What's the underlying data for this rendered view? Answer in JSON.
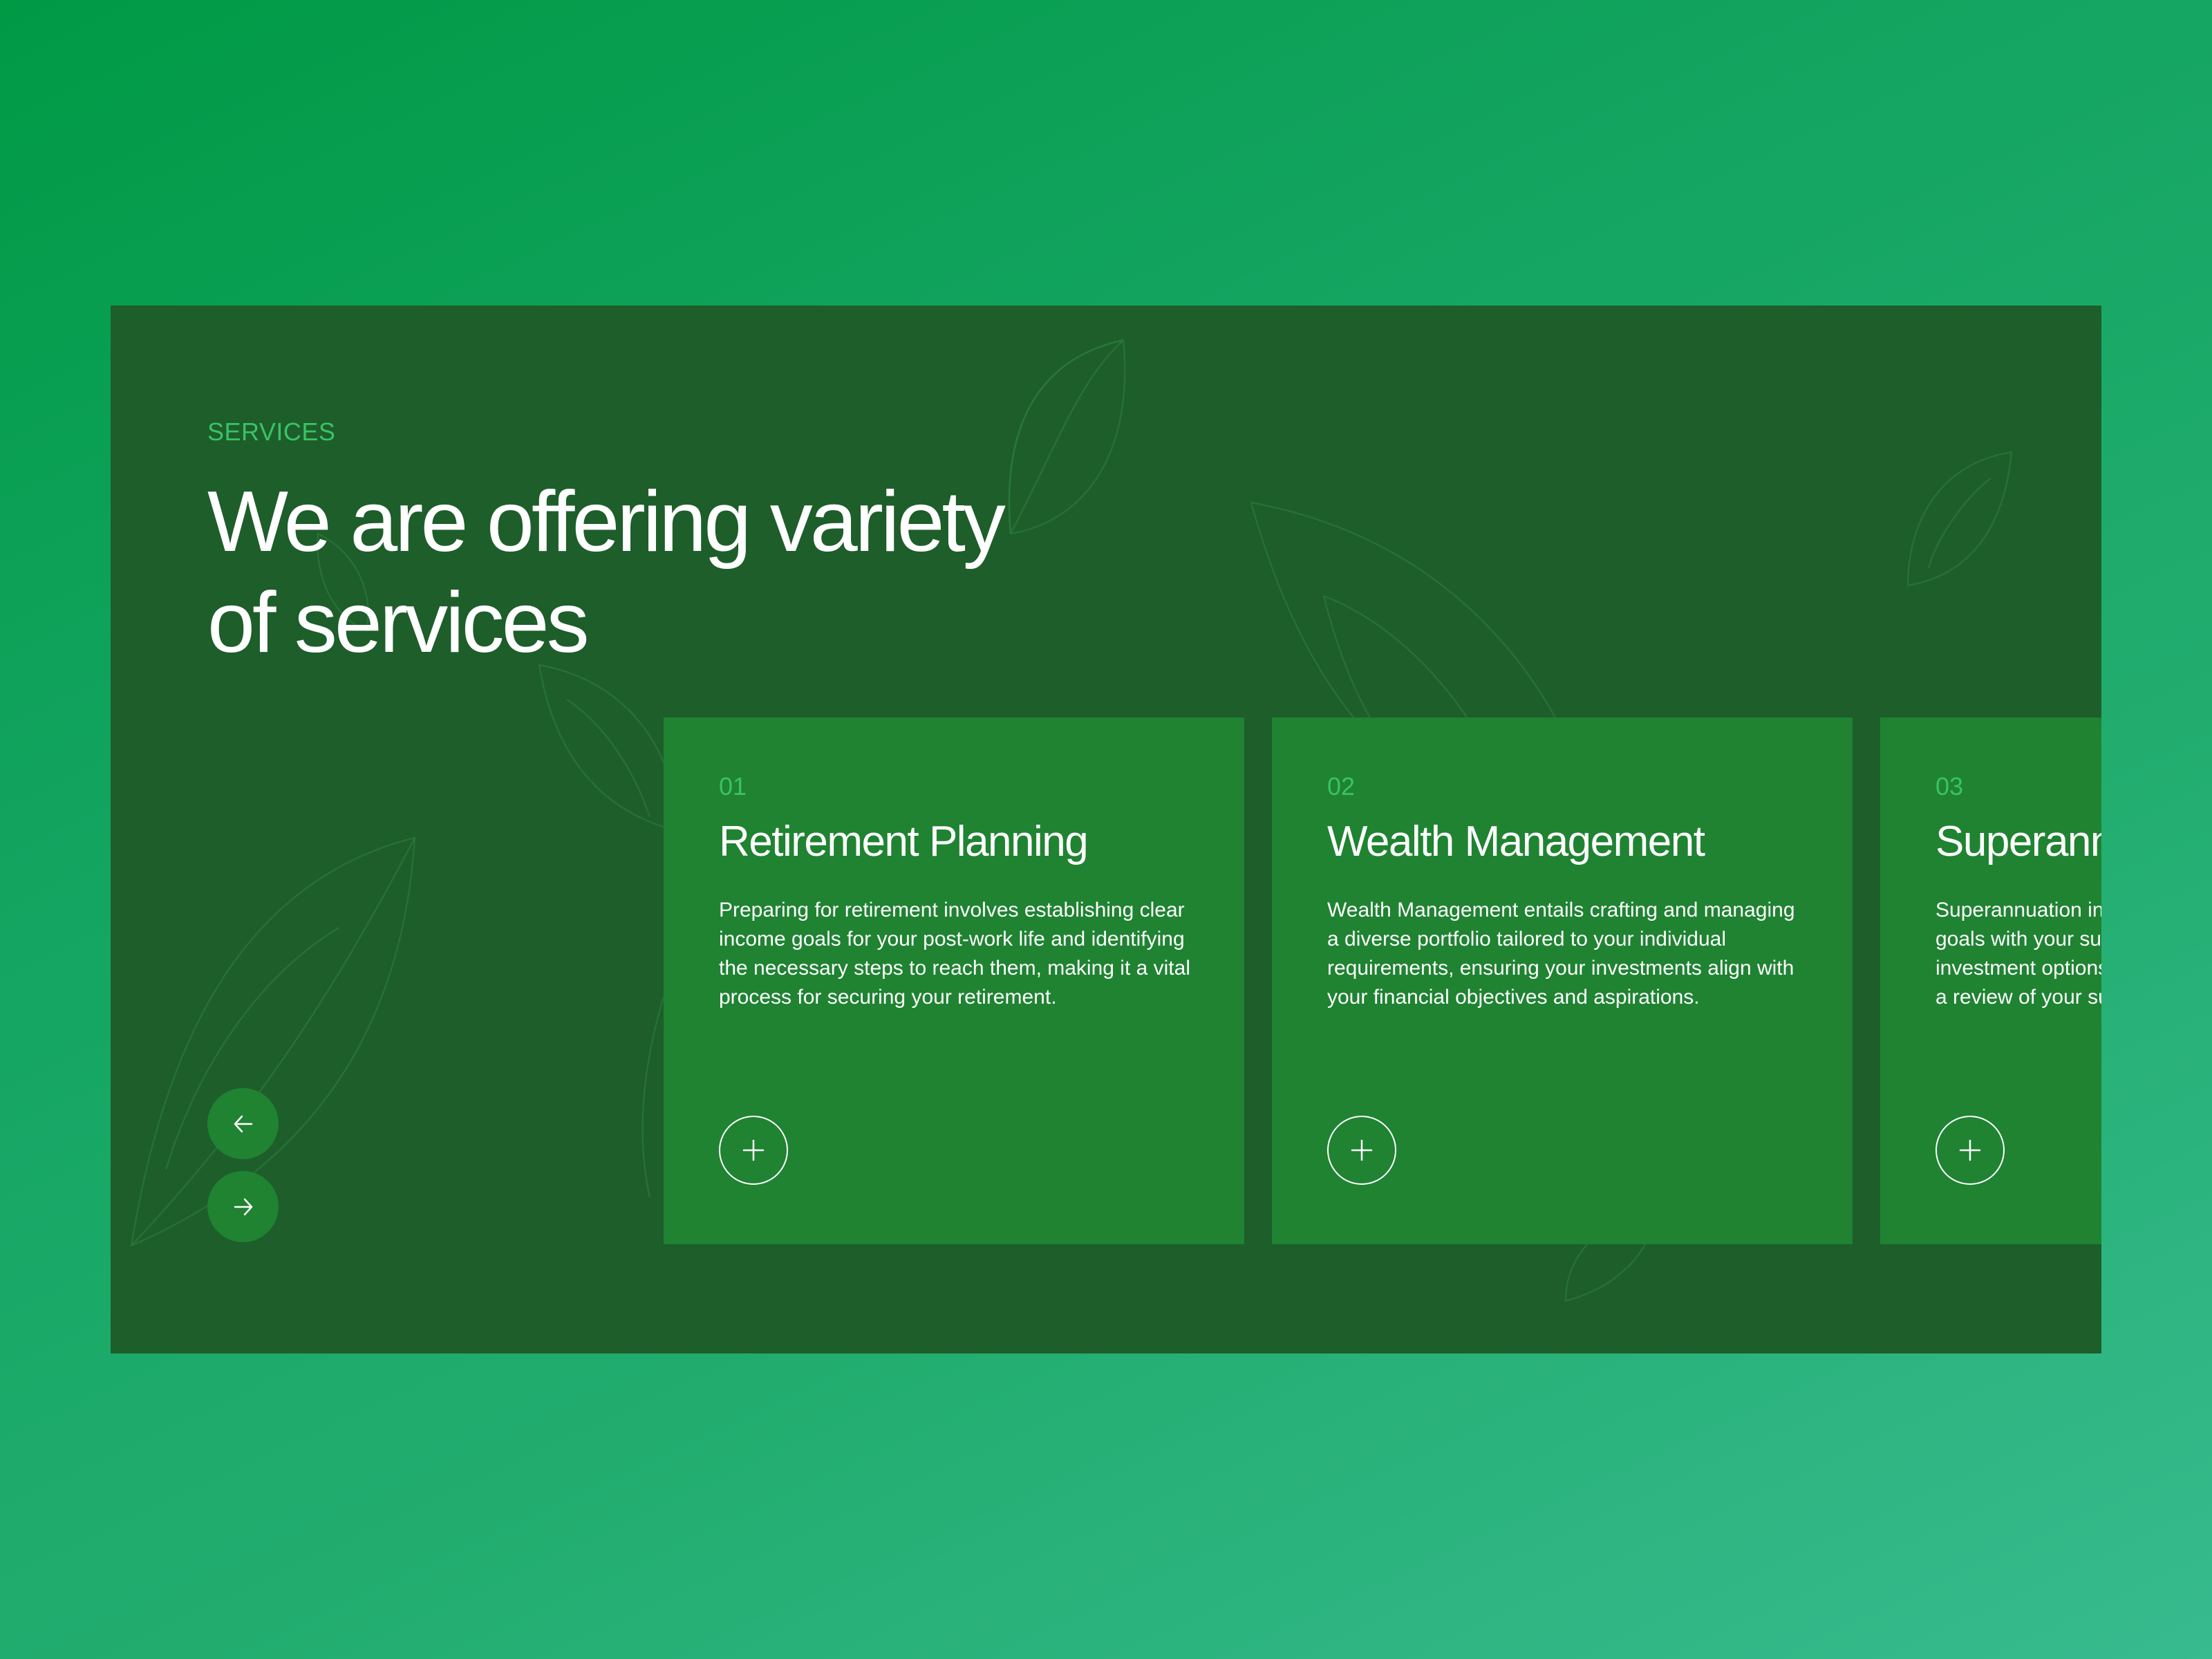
{
  "section": {
    "eyebrow": "SERVICES",
    "headline_line1": "We are offering variety",
    "headline_line2": "of services"
  },
  "nav": {
    "prev_icon": "arrow-left-icon",
    "next_icon": "arrow-right-icon"
  },
  "cards": [
    {
      "number": "01",
      "title": "Retirement Planning",
      "body": "Preparing for retirement involves establishing clear income goals for your post-work life and identifying the necessary steps to reach them, making it a vital process for securing your retirement.",
      "action_icon": "plus-icon"
    },
    {
      "number": "02",
      "title": "Wealth Management",
      "body": "Wealth Management entails crafting and managing a diverse portfolio tailored to your individual requirements, ensuring your investments align with your financial objectives and aspirations.",
      "action_icon": "plus-icon"
    },
    {
      "number": "03",
      "title": "Superannuation",
      "body": "Superannuation involves aligning your retirement goals with your superannuation, reviewing your investment options and contributions. We'll conduct a review of your superannuation strategy.",
      "action_icon": "plus-icon"
    }
  ],
  "colors": {
    "page_gradient_start": "#009a45",
    "page_gradient_end": "#37bb8f",
    "panel_bg": "#1d5e2a",
    "card_bg": "#1f8332",
    "accent": "#39c366",
    "text": "#ffffff"
  }
}
